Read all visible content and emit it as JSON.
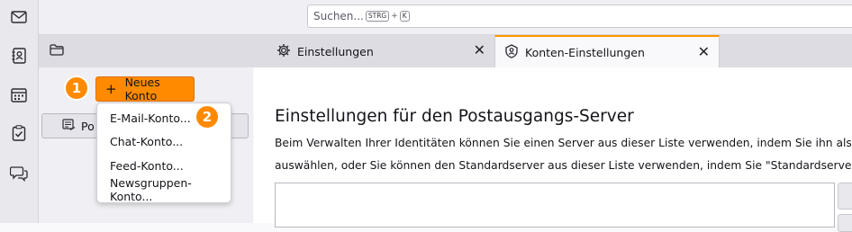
{
  "spaces": [
    {
      "icon": "mail-icon"
    },
    {
      "icon": "address-book-icon"
    },
    {
      "icon": "calendar-icon"
    },
    {
      "icon": "tasks-icon"
    },
    {
      "icon": "chat-icon"
    }
  ],
  "search": {
    "placeholder": "Suchen...",
    "key1": "STRG",
    "key_sep": "+",
    "key2": "K"
  },
  "tabs": [
    {
      "label": "Einstellungen",
      "icon": "gear-icon"
    },
    {
      "label": "Konten-Einstellungen",
      "icon": "account-icon",
      "active": true
    }
  ],
  "left_pane": {
    "new_account_label": "Neues Konto",
    "postausgang_label": "Po"
  },
  "badges": [
    "1",
    "2"
  ],
  "new_account_menu": [
    "E-Mail-Konto...",
    "Chat-Konto...",
    "Feed-Konto...",
    "Newsgruppen-Konto..."
  ],
  "content": {
    "heading": "Einstellungen für den Postausgangs-Server",
    "line1": "Beim Verwalten Ihrer Identitäten können Sie einen Server aus dieser Liste verwenden, indem Sie ihn als den Au",
    "line2": "auswählen, oder Sie können den Standardserver aus dieser Liste verwenden, indem Sie \"Standardserver verwen"
  },
  "colors": {
    "accent": "#ff8a00",
    "tab_indicator": "#ff9400"
  }
}
